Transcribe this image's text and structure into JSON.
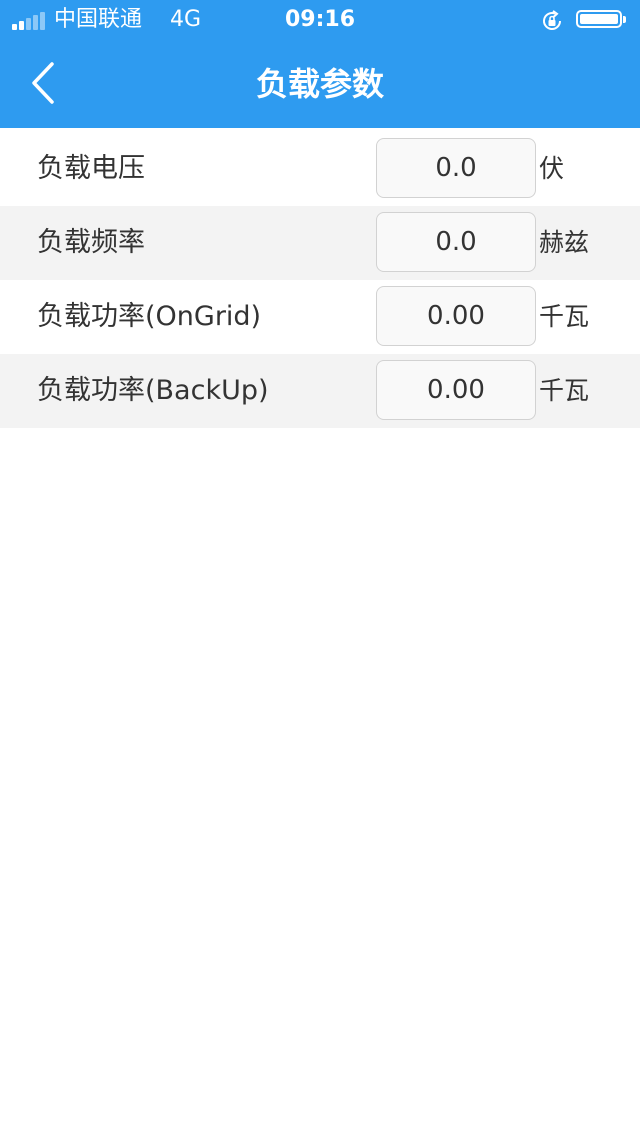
{
  "status_bar": {
    "carrier": "中国联通",
    "network": "4G",
    "time": "09:16"
  },
  "nav": {
    "title": "负载参数"
  },
  "rows": [
    {
      "label": "负载电压",
      "value": "0.0",
      "unit": "伏"
    },
    {
      "label": "负载频率",
      "value": "0.0",
      "unit": "赫兹"
    },
    {
      "label": "负载功率(OnGrid)",
      "value": "0.00",
      "unit": "千瓦"
    },
    {
      "label": "负载功率(BackUp)",
      "value": "0.00",
      "unit": "千瓦"
    }
  ],
  "colors": {
    "accent": "#2e9bf0",
    "row_alt": "#f3f3f3",
    "text": "#333333"
  },
  "icons": {
    "back": "chevron-left-icon",
    "rotation_lock": "rotation-lock-icon",
    "battery": "battery-icon",
    "signal": "signal-icon"
  }
}
